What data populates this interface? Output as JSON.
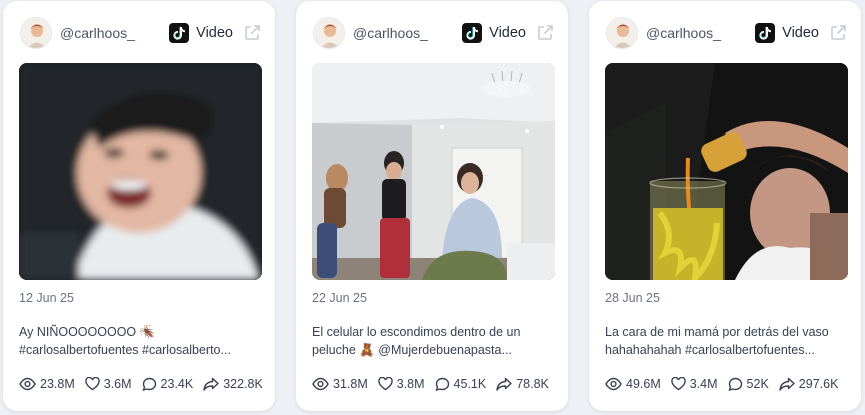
{
  "posts": [
    {
      "username": "@carlhoos_",
      "platform": "Video",
      "date": "12 Jun 25",
      "caption_lines": [
        "Ay NIÑOOOOOOOO 🪳",
        "#carlosalbertofuentes #carlosalberto..."
      ],
      "stats": {
        "views": "23.8M",
        "likes": "3.6M",
        "comments": "23.4K",
        "shares": "322.8K"
      }
    },
    {
      "username": "@carlhoos_",
      "platform": "Video",
      "date": "22 Jun 25",
      "caption_lines": [
        "El celular lo escondimos dentro de un",
        "peluche 🧸 @Mujerdebuenapasta..."
      ],
      "stats": {
        "views": "31.8M",
        "likes": "3.8M",
        "comments": "45.1K",
        "shares": "78.8K"
      }
    },
    {
      "username": "@carlhoos_",
      "platform": "Video",
      "date": "28 Jun 25",
      "caption_lines": [
        "La cara de mi mamá por detrás del vaso",
        "hahahahahah #carlosalbertofuentes..."
      ],
      "stats": {
        "views": "49.6M",
        "likes": "3.4M",
        "comments": "52K",
        "shares": "297.6K"
      }
    }
  ]
}
